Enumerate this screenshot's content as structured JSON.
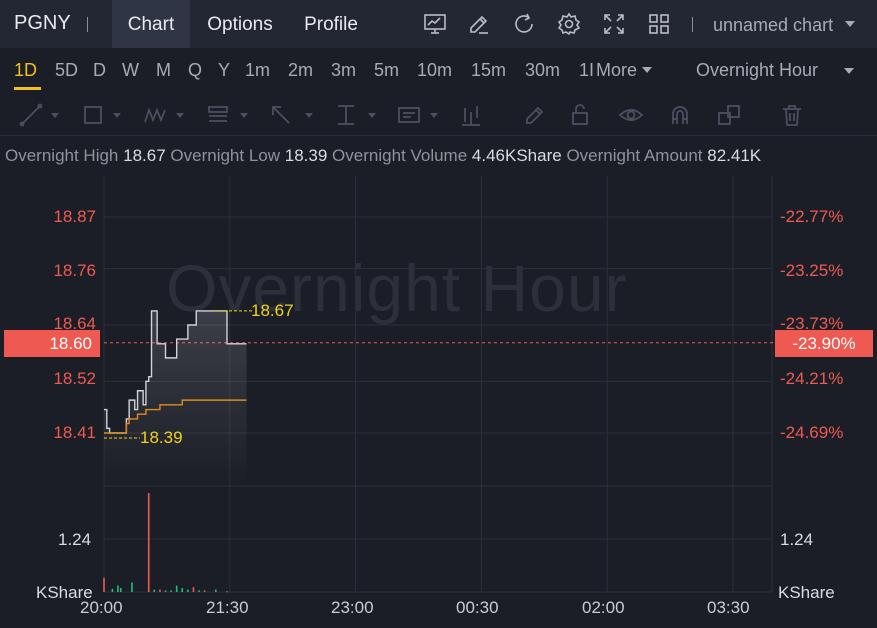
{
  "header": {
    "ticker": "PGNY",
    "tabs": [
      {
        "label": "Chart",
        "active": true
      },
      {
        "label": "Options",
        "active": false
      },
      {
        "label": "Profile",
        "active": false
      }
    ],
    "icons": [
      "indicator-icon",
      "draw-icon",
      "refresh-icon",
      "settings-icon",
      "fullscreen-icon",
      "layout-icon"
    ],
    "chart_name": "unnamed chart"
  },
  "intervals": {
    "items": [
      "1D",
      "5D",
      "D",
      "W",
      "M",
      "Q",
      "Y",
      "1m",
      "2m",
      "3m",
      "5m",
      "10m",
      "15m",
      "30m",
      "1I"
    ],
    "active": "1D",
    "more_label": "More",
    "session_label": "Overnight Hour"
  },
  "tools": [
    "trend-line-icon",
    "rectangle-icon",
    "pattern-icon",
    "text-note-icon",
    "arrow-icon",
    "measure-icon",
    "label-icon",
    "bar-pattern-icon",
    "brush-icon",
    "lock-icon",
    "eye-icon",
    "magnet-icon",
    "duplicate-icon",
    "trash-icon"
  ],
  "info": {
    "high_label": "Overnight High",
    "high_value": "18.67",
    "low_label": "Overnight Low",
    "low_value": "18.39",
    "volume_label": "Overnight Volume",
    "volume_value": "4.46KShare",
    "amount_label": "Overnight Amount",
    "amount_value": "82.41K"
  },
  "watermark": "Overnight Hour",
  "price_axis": {
    "left_labels": [
      "18.87",
      "18.76",
      "18.64",
      "18.52",
      "18.41"
    ],
    "right_labels": [
      "-22.77%",
      "-23.25%",
      "-23.73%",
      "-24.21%",
      "-24.69%"
    ],
    "current_price": "18.60",
    "current_pct": "-23.90%"
  },
  "annotations": {
    "high": "18.67",
    "low": "18.39"
  },
  "volume_axis": {
    "left_value": "1.24",
    "right_value": "1.24",
    "left_unit": "KShare",
    "right_unit": "KShare"
  },
  "time_axis": [
    "20:00",
    "21:30",
    "23:00",
    "00:30",
    "02:00",
    "03:30"
  ],
  "colors": {
    "accent": "#f0c020",
    "down": "#ee5a52",
    "up": "#1fbf75",
    "avg_line": "#e08a1e",
    "price_line": "#d0d3da"
  },
  "chart_data": {
    "type": "line",
    "x_range": [
      "20:00",
      "03:30"
    ],
    "ylim": [
      18.35,
      18.92
    ],
    "x": [
      "20:00",
      "20:02",
      "20:04",
      "20:06",
      "20:10",
      "20:14",
      "20:16",
      "20:18",
      "20:20",
      "20:22",
      "20:24",
      "20:26",
      "20:28",
      "20:30",
      "20:32",
      "20:34",
      "20:38",
      "20:40",
      "20:44",
      "20:48",
      "20:52",
      "20:56",
      "21:00",
      "21:04",
      "21:06",
      "21:08",
      "21:12",
      "21:16",
      "21:20",
      "21:24",
      "21:28",
      "21:34",
      "21:38",
      "21:42"
    ],
    "series": [
      {
        "values": [
          18.46,
          18.42,
          18.41,
          18.41,
          18.41,
          18.41,
          18.44,
          18.48,
          18.48,
          18.46,
          18.5,
          18.5,
          18.47,
          18.52,
          18.53,
          18.67,
          18.6,
          18.6,
          18.57,
          18.57,
          18.61,
          18.61,
          18.64,
          18.64,
          18.67,
          18.67,
          18.67,
          18.67,
          18.67,
          18.67,
          18.6,
          18.6,
          18.6,
          18.6
        ]
      },
      {
        "values": [
          18.41,
          18.41,
          18.41,
          18.41,
          18.41,
          18.41,
          18.43,
          18.44,
          18.44,
          18.44,
          18.45,
          18.45,
          18.45,
          18.46,
          18.46,
          18.46,
          18.46,
          18.47,
          18.47,
          18.47,
          18.47,
          18.48,
          18.48,
          18.48,
          18.48,
          18.48,
          18.48,
          18.48,
          18.48,
          18.48,
          18.48,
          18.48,
          18.48,
          18.48
        ]
      }
    ],
    "volume": {
      "x": [
        "20:00",
        "20:06",
        "20:10",
        "20:12",
        "20:20",
        "20:32",
        "20:36",
        "20:40",
        "20:44",
        "20:48",
        "20:52",
        "20:56",
        "21:00",
        "21:04",
        "21:08",
        "21:12",
        "21:20",
        "21:28"
      ],
      "values": [
        0.18,
        0.04,
        0.08,
        0.05,
        0.12,
        1.24,
        0.03,
        0.03,
        0.02,
        0.02,
        0.08,
        0.05,
        0.03,
        0.06,
        0.02,
        0.02,
        0.03,
        0.01
      ],
      "direction": [
        "down",
        "up",
        "up",
        "up",
        "up",
        "down",
        "up",
        "down",
        "up",
        "up",
        "up",
        "up",
        "up",
        "down",
        "up",
        "down",
        "up",
        "up"
      ]
    }
  }
}
